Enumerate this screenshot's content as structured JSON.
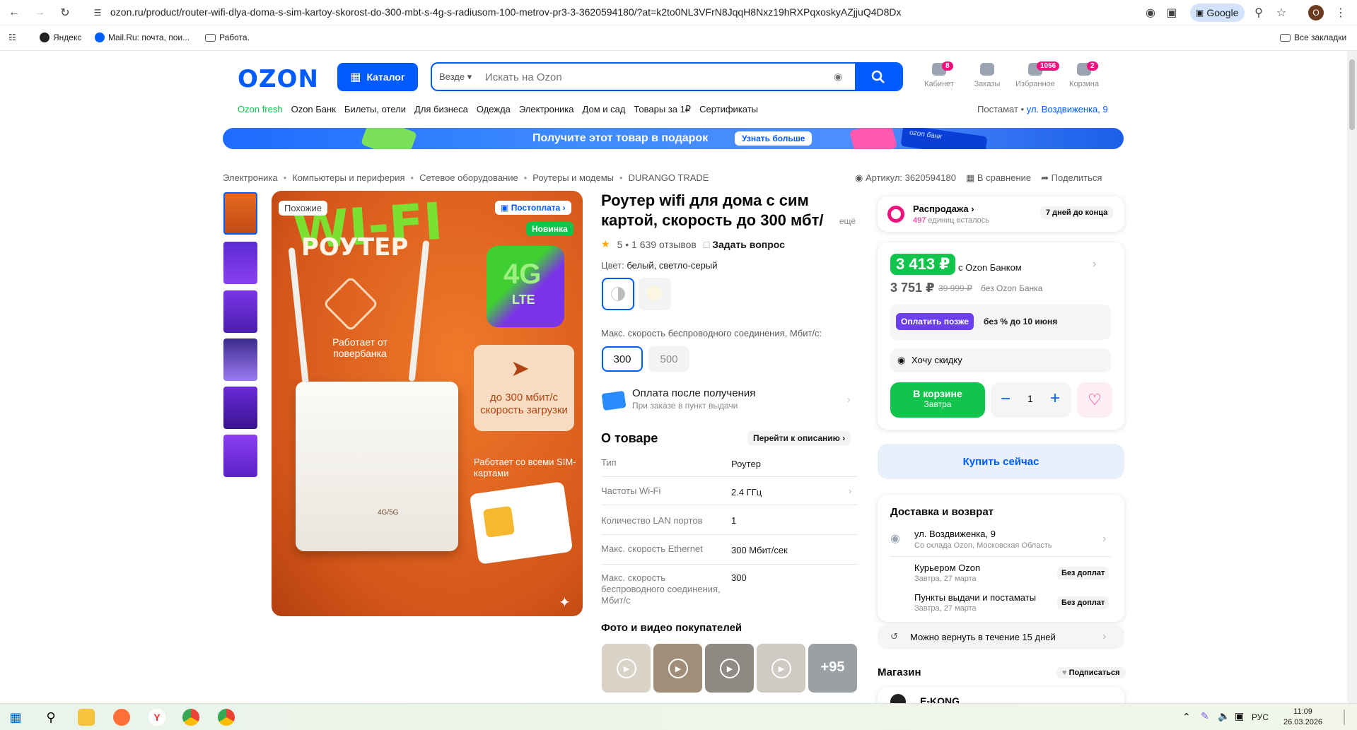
{
  "browser": {
    "url": "ozon.ru/product/router-wifi-dlya-doma-s-sim-kartoy-skorost-do-300-mbt-s-4g-s-radiusom-100-metrov-pr3-3-3620594180/?at=k2to0NL3VFrN8JqqH8Nxz19hRXPqxoskyAZjjuQ4D8Dx",
    "google_label": "Google",
    "profile_initial": "O",
    "bookmarks": [
      "Яндекс",
      "Mail.Ru: почта, пои...",
      "Работа."
    ],
    "all_bookmarks": "Все закладки"
  },
  "header": {
    "logo": "OZON",
    "catalog": "Каталог",
    "search_scope": "Везде",
    "search_placeholder": "Искать на Ozon",
    "icons": [
      {
        "label": "Кабинет",
        "badge": "8"
      },
      {
        "label": "Заказы",
        "badge": ""
      },
      {
        "label": "Избранное",
        "badge": "1056"
      },
      {
        "label": "Корзина",
        "badge": "2"
      }
    ],
    "subnav": [
      "Ozon fresh",
      "Ozon Банк",
      "Билеты, отели",
      "Для бизнеса",
      "Одежда",
      "Электроника",
      "Дом и сад",
      "Товары за 1₽",
      "Сертификаты"
    ],
    "deliver_label": "Постамат •",
    "deliver_address": "ул. Воздвиженка, 9"
  },
  "promo": {
    "text": "Получите этот товар в подарок",
    "button": "Узнать больше",
    "card_text": "ozon банк"
  },
  "breadcrumb": [
    "Электроника",
    "Компьютеры и периферия",
    "Сетевое оборудование",
    "Роутеры и модемы",
    "DURANGO TRADE"
  ],
  "meta": {
    "article": "Артикул: 3620594180",
    "compare": "В сравнение",
    "share": "Поделиться"
  },
  "image": {
    "similar": "Похожие",
    "postpay": "Постоплата",
    "new": "Новинка",
    "wifi": "WI-FI",
    "router": "РОУТЕР",
    "lte_top": "4G",
    "lte_bottom": "LTE",
    "power": "Работает от повербанка",
    "speed": "до 300 мбит/с скорость загрузки",
    "sim": "Работает со всеми SIM-картами",
    "router_label": "4G/5G"
  },
  "product": {
    "title": "Роутер wifi для дома с сим картой, скорость до 300 мбт/",
    "more": "ещё",
    "rating": "5",
    "reviews": "1 639 отзывов",
    "ask": "Задать вопрос",
    "color_label": "Цвет:",
    "color_value": "белый, светло-серый",
    "speed_label": "Макс. скорость беспроводного соединения, Мбит/с:",
    "speed_options": [
      "300",
      "500"
    ],
    "payafter_title": "Оплата после получения",
    "payafter_sub": "При заказе в пункт выдачи",
    "about_title": "О товаре",
    "about_link": "Перейти к описанию",
    "specs": [
      {
        "k": "Тип",
        "v": "Роутер"
      },
      {
        "k": "Частоты Wi-Fi",
        "v": "2.4 ГГц"
      },
      {
        "k": "Количество LAN портов",
        "v": "1"
      },
      {
        "k": "Макс. скорость Ethernet",
        "v": "300 Мбит/сек"
      },
      {
        "k": "Макс. скорость беспроводного соединения, Мбит/с",
        "v": "300"
      }
    ],
    "photos_title": "Фото и видео покупателей",
    "photos_more": "+95"
  },
  "sidebar": {
    "sale_title": "Распродажа",
    "sale_count": "497",
    "sale_sub": "единиц осталось",
    "sale_days": "7 дней до конца",
    "price_bank": "3 413 ₽",
    "price_bank_label": "с Ozon Банком",
    "price": "3 751 ₽",
    "price_old": "39 999 ₽",
    "price_label": "без Ozon Банка",
    "pay_later": "Оплатить позже",
    "pay_later_text": "без % до 10 июня",
    "want_discount": "Хочу скидку",
    "cart_title": "В корзине",
    "cart_sub": "Завтра",
    "qty": "1",
    "buy_now": "Купить сейчас",
    "delivery_title": "Доставка и возврат",
    "address": "ул. Воздвиженка, 9",
    "address_sub": "Со склада Ozon, Московская Область",
    "courier": "Курьером Ozon",
    "courier_sub": "Завтра, 27 марта",
    "courier_price": "Без доплат",
    "pickup": "Пункты выдачи и постаматы",
    "pickup_sub": "Завтра, 27 марта",
    "pickup_price": "Без доплат",
    "return": "Можно вернуть в течение 15 дней",
    "shop_title": "Магазин",
    "subscribe": "Подписаться",
    "shop_name": "E-KONG"
  },
  "taskbar": {
    "lang": "РУС",
    "time": "11:09",
    "date": "26.03.2026"
  },
  "colors": {
    "ozon_blue": "#005bff",
    "green": "#10c44c",
    "pink": "#f1117e"
  }
}
